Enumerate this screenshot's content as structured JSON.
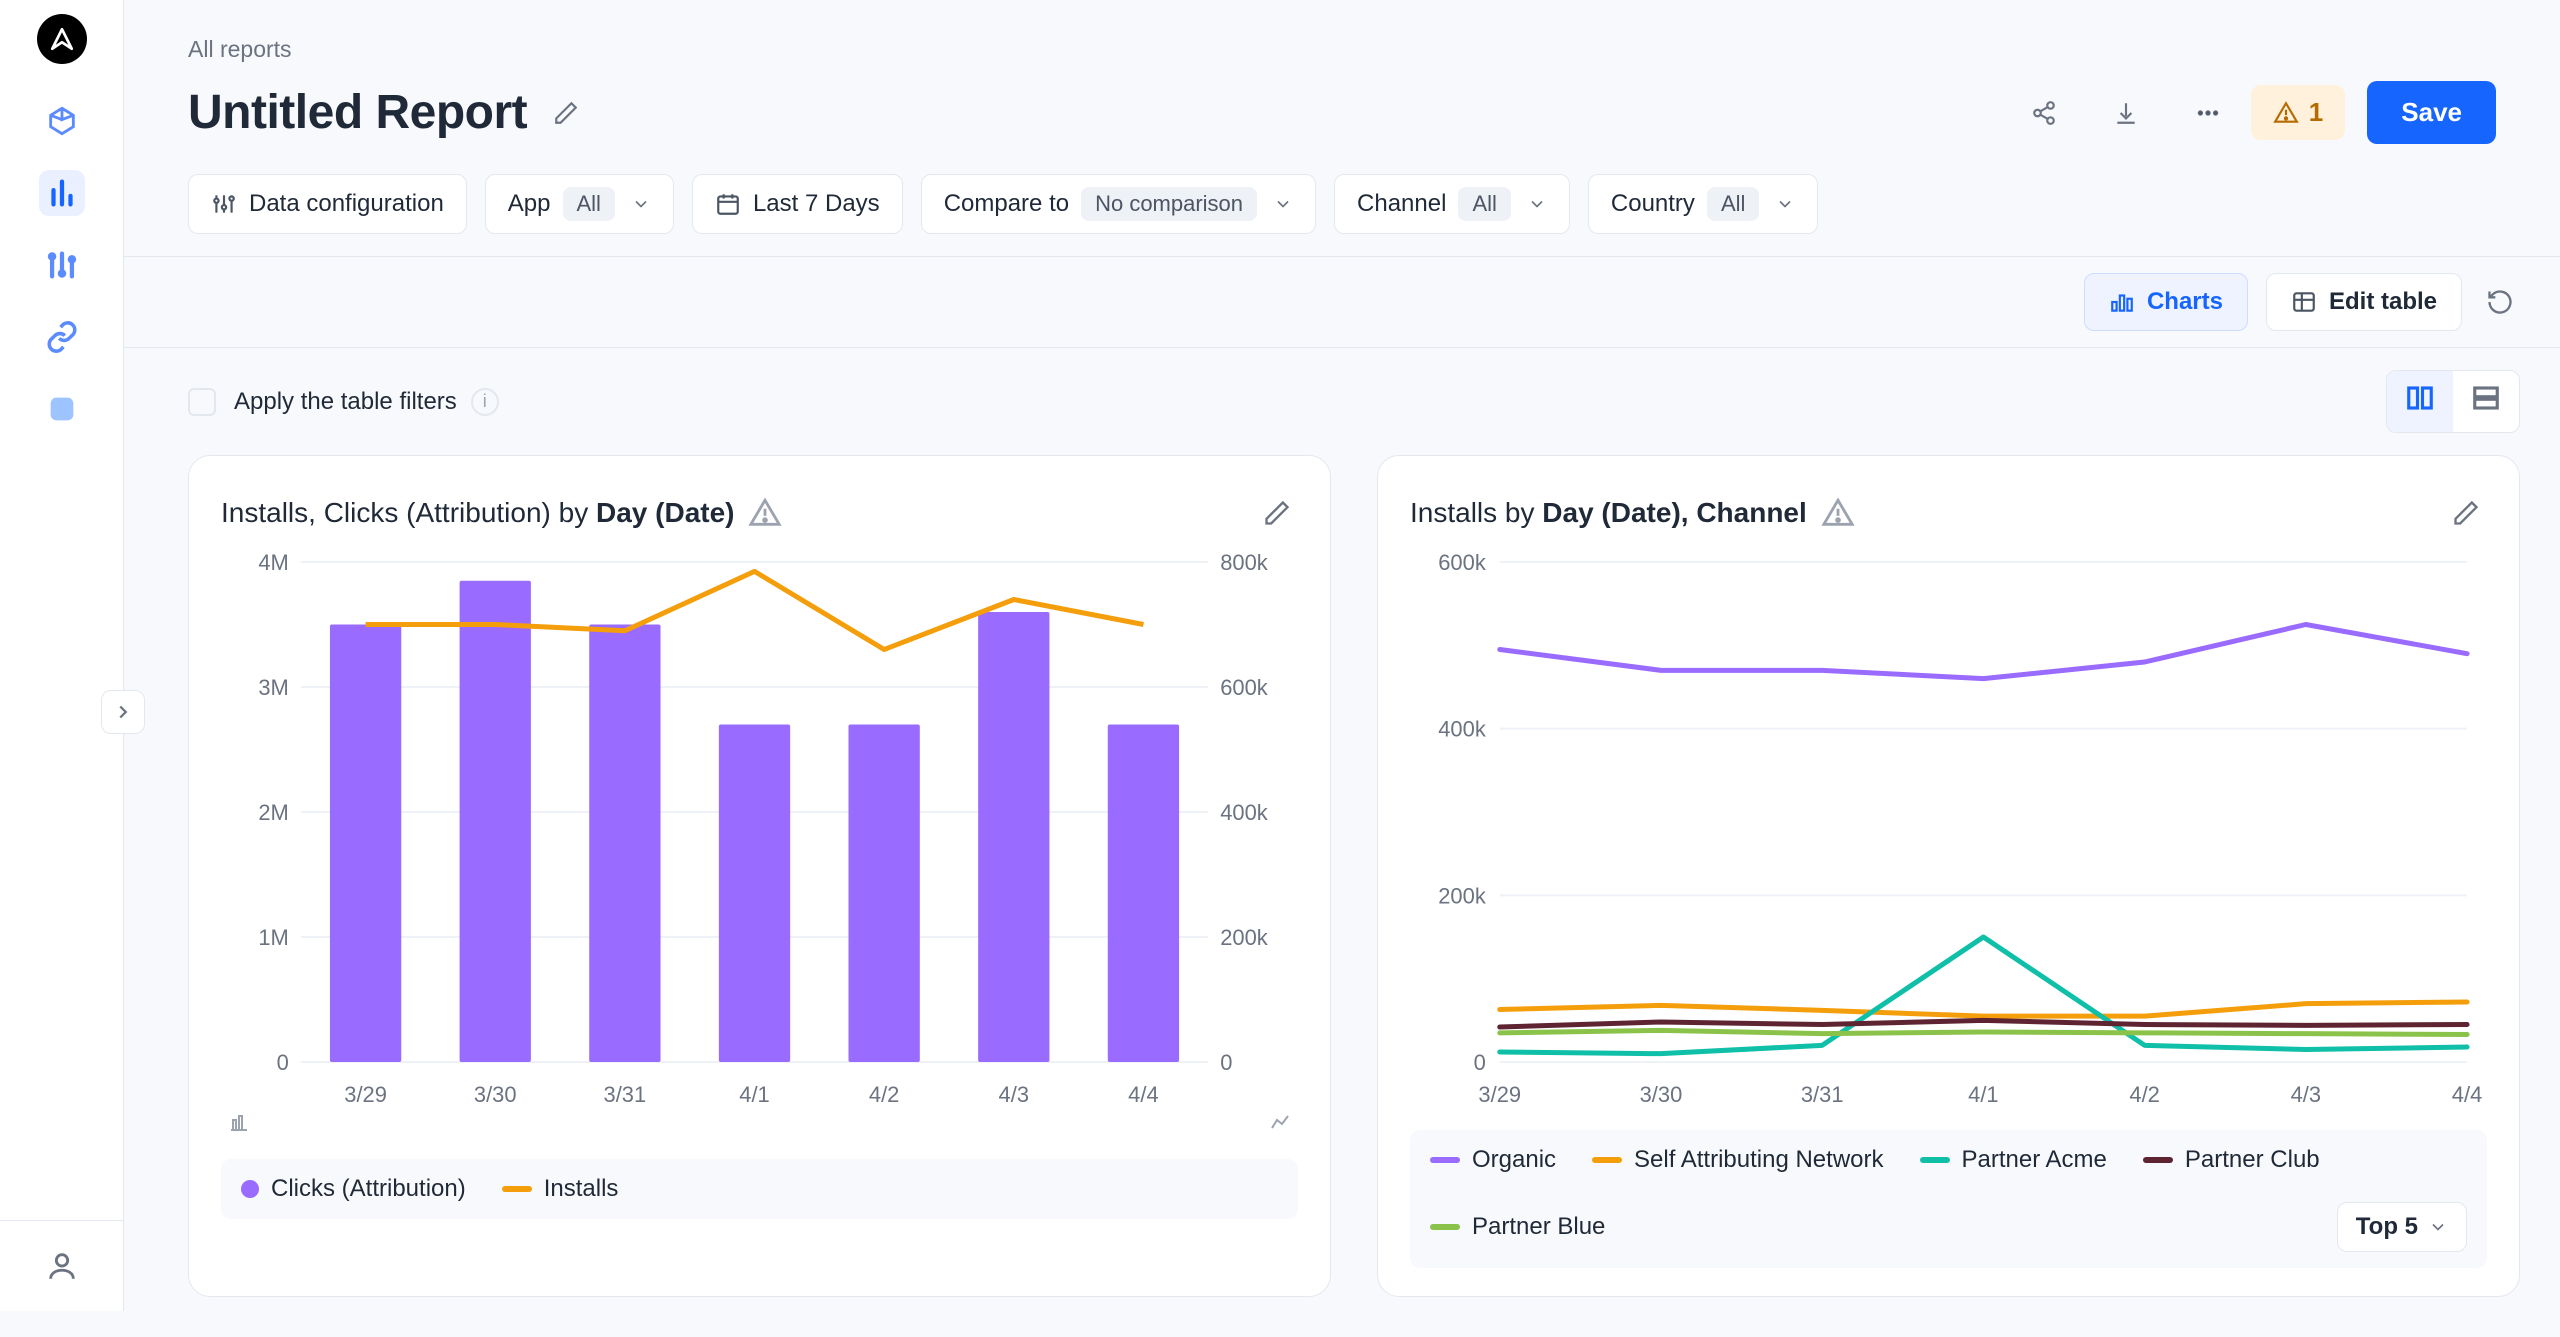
{
  "breadcrumb": "All reports",
  "title": "Untitled Report",
  "warning_count": "1",
  "save_label": "Save",
  "filters": {
    "data_config": "Data configuration",
    "app": {
      "label": "App",
      "value": "All"
    },
    "date_range": "Last 7 Days",
    "compare": {
      "label": "Compare to",
      "value": "No comparison"
    },
    "channel": {
      "label": "Channel",
      "value": "All"
    },
    "country": {
      "label": "Country",
      "value": "All"
    }
  },
  "subtoolbar": {
    "charts_label": "Charts",
    "edit_table_label": "Edit table"
  },
  "tablefilters": {
    "label": "Apply the table filters"
  },
  "top5_label": "Top 5",
  "colors": {
    "purple": "#9a6bff",
    "orange": "#f59e0b",
    "teal": "#0fbfa8",
    "darkred": "#5e2432",
    "lime": "#8bc34a"
  },
  "chart_data": [
    {
      "id": "left",
      "title_prefix": "Installs, Clicks (Attribution) by ",
      "title_dim": "Day (Date)",
      "type": "bar+line",
      "categories": [
        "3/29",
        "3/30",
        "3/31",
        "4/1",
        "4/2",
        "4/3",
        "4/4"
      ],
      "y_left_label": "",
      "y_right_label": "",
      "y_left_ticks": [
        "0",
        "1M",
        "2M",
        "3M",
        "4M"
      ],
      "y_right_ticks": [
        "0",
        "200k",
        "400k",
        "600k",
        "800k"
      ],
      "y_left_lim": [
        0,
        4000000
      ],
      "y_right_lim": [
        0,
        800000
      ],
      "series": [
        {
          "name": "Clicks (Attribution)",
          "type": "bar",
          "axis": "left",
          "color": "purple",
          "values": [
            3500000,
            3850000,
            3500000,
            2700000,
            2700000,
            3600000,
            2700000
          ]
        },
        {
          "name": "Installs",
          "type": "line",
          "axis": "right",
          "color": "orange",
          "values": [
            700000,
            700000,
            690000,
            785000,
            660000,
            740000,
            700000
          ]
        }
      ]
    },
    {
      "id": "right",
      "title_prefix": "Installs by ",
      "title_dim": "Day (Date), Channel",
      "type": "line",
      "categories": [
        "3/29",
        "3/30",
        "3/31",
        "4/1",
        "4/2",
        "4/3",
        "4/4"
      ],
      "y_ticks": [
        "0",
        "200k",
        "400k",
        "600k"
      ],
      "y_lim": [
        0,
        600000
      ],
      "series": [
        {
          "name": "Organic",
          "color": "purple",
          "values": [
            495000,
            470000,
            470000,
            460000,
            480000,
            525000,
            490000
          ]
        },
        {
          "name": "Self Attributing Network",
          "color": "orange",
          "values": [
            63000,
            68000,
            62000,
            55000,
            55000,
            70000,
            72000
          ]
        },
        {
          "name": "Partner Acme",
          "color": "teal",
          "values": [
            12000,
            10000,
            20000,
            150000,
            20000,
            15000,
            18000
          ]
        },
        {
          "name": "Partner Club",
          "color": "darkred",
          "values": [
            42000,
            48000,
            45000,
            50000,
            45000,
            44000,
            45000
          ]
        },
        {
          "name": "Partner Blue",
          "color": "lime",
          "values": [
            35000,
            38000,
            34000,
            36000,
            35000,
            34000,
            33000
          ]
        }
      ]
    }
  ]
}
